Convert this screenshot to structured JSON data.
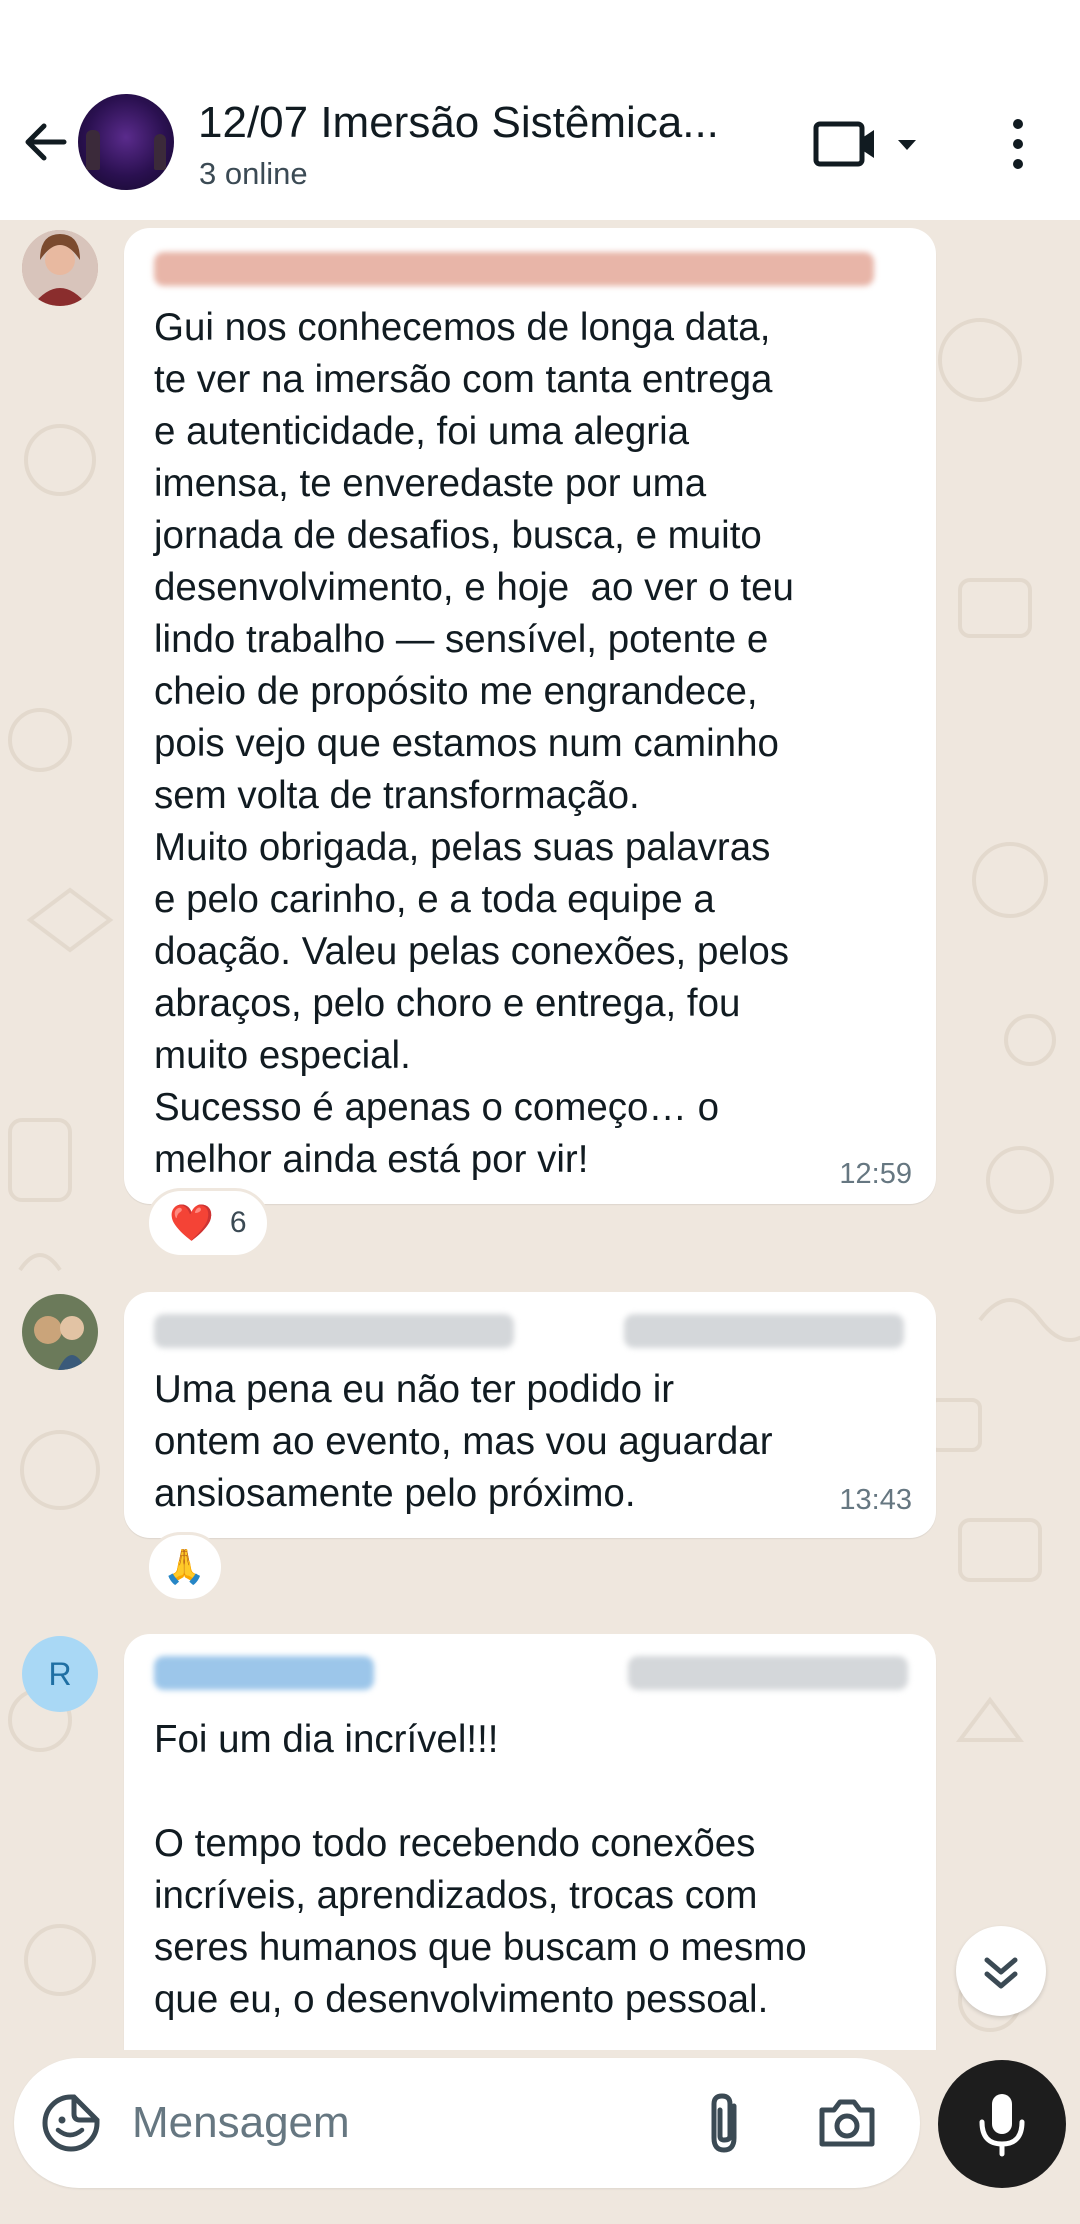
{
  "header": {
    "back_icon": "arrow-left-icon",
    "title": "12/07 Imersão Sistêmica...",
    "subtitle": "3 online",
    "video_icon": "video-call-icon",
    "dropdown_icon": "caret-down-icon",
    "menu_icon": "vertical-ellipsis-icon"
  },
  "messages": [
    {
      "text": "Gui nos conhecemos de longa data,\nte ver na imersão com tanta entrega\ne autenticidade, foi uma alegria\nimensa, te enveredaste por uma\njornada de desafios, busca, e muito\ndesenvolvimento, e hoje  ao ver o teu\nlindo trabalho — sensível, potente e\ncheio de propósito me engrandece,\npois vejo que estamos num caminho\nsem volta de transformação.\nMuito obrigada, pelas suas palavras\ne pelo carinho, e a toda equipe a\ndoação. Valeu pelas conexões, pelos\nabraços, pelo choro e entrega, fou\nmuito especial.\nSucesso é apenas o começo… o\nmelhor ainda está por vir!",
      "time": "12:59",
      "reaction_emoji": "❤️",
      "reaction_count": "6"
    },
    {
      "text": "Uma pena eu não ter podido ir\nontem ao evento, mas vou aguardar\nansiosamente pelo próximo.",
      "time": "13:43",
      "reaction_emoji": "🙏"
    },
    {
      "avatar_letter": "R",
      "text": "Foi um dia incrível!!!\n\nO tempo todo recebendo conexões\nincríveis, aprendizados, trocas com\nseres humanos que buscam o mesmo\nque eu, o desenvolvimento pessoal."
    }
  ],
  "composer": {
    "placeholder": "Mensagem",
    "sticker_icon": "sticker-icon",
    "attach_icon": "paperclip-icon",
    "camera_icon": "camera-icon",
    "mic_icon": "microphone-icon"
  },
  "colors": {
    "wallpaper": "#efe7de",
    "bubble": "#ffffff",
    "heart": "#e0245e",
    "mic_button": "#1d1d1d",
    "avatar_letter_bg": "#a9d8f5",
    "avatar_letter_fg": "#1f6fa3"
  }
}
